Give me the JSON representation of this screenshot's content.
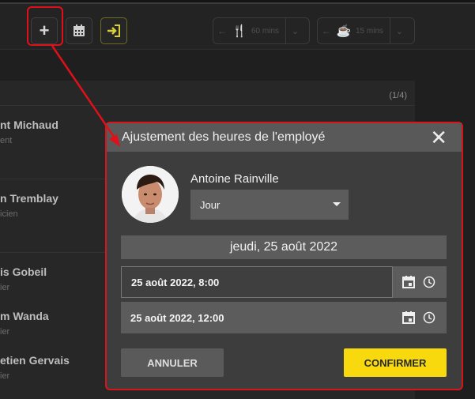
{
  "toolbar": {
    "add_icon": "plus-icon",
    "calendar_icon": "calendar-icon",
    "login_icon": "sign-in-icon",
    "meal": {
      "label": "60 mins",
      "icon": "fork-knife-icon"
    },
    "coffee": {
      "label": "15 mins",
      "icon": "coffee-cup-icon"
    }
  },
  "list": {
    "pager": "(1/4)",
    "employees": [
      {
        "name": "nt Michaud",
        "role": "ent"
      },
      {
        "name": "n Tremblay",
        "role": "icien"
      },
      {
        "name": "is Gobeil",
        "role": "ier"
      },
      {
        "name": "m Wanda",
        "role": "ier"
      },
      {
        "name": "etien Gervais",
        "role": "ier"
      }
    ]
  },
  "dialog": {
    "title": "Ajustement des heures de l'employé",
    "employee_name": "Antoine Rainville",
    "type_select": "Jour",
    "date_header": "jeudi, 25 août 2022",
    "start_datetime": "25 août 2022, 8:00",
    "end_datetime": "25 août 2022, 12:00",
    "cancel_label": "ANNULER",
    "confirm_label": "CONFIRMER"
  },
  "colors": {
    "highlight": "#e0101a",
    "confirm": "#f7d90e",
    "header": "#595959"
  }
}
